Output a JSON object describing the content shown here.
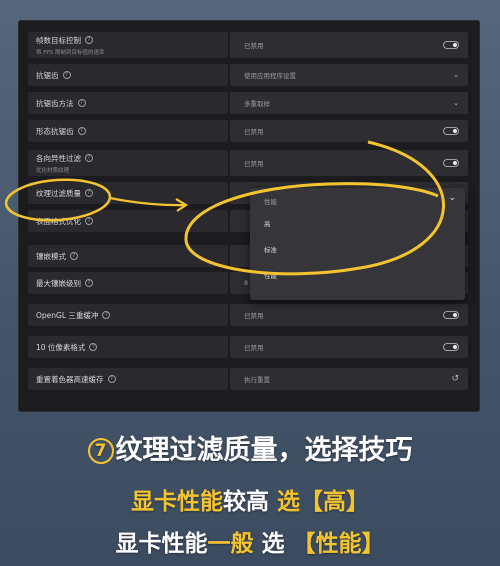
{
  "settings": [
    {
      "label": "帧数目标控制",
      "sub": "将 FPS 限制到目标值的速率",
      "value": "已禁用",
      "control": "toggle"
    },
    {
      "label": "抗锯齿",
      "sub": "",
      "value": "使用应用程序设置",
      "control": "chevron"
    },
    {
      "label": "抗锯齿方法",
      "sub": "",
      "value": "多重取样",
      "control": "chevron"
    },
    {
      "label": "形态抗锯齿",
      "sub": "",
      "value": "已禁用",
      "control": "toggle"
    },
    {
      "label": "各向异性过滤",
      "sub": "优化材质纹理",
      "value": "已禁用",
      "control": "toggle"
    },
    {
      "label": "纹理过滤质量",
      "sub": "",
      "value": "性能",
      "control": "chevron"
    },
    {
      "label": "表面格式优化",
      "sub": "",
      "value": "",
      "control": "none"
    },
    {
      "label": "镶嵌模式",
      "sub": "",
      "value": "",
      "control": "none"
    },
    {
      "label": "最大镶嵌级别",
      "sub": "",
      "value": "8",
      "control": "chevron"
    },
    {
      "label": "OpenGL 三重缓冲",
      "sub": "",
      "value": "已禁用",
      "control": "toggle"
    },
    {
      "label": "10 位像素格式",
      "sub": "",
      "value": "已禁用",
      "control": "toggle"
    },
    {
      "label": "重置着色器高速缓存",
      "sub": "",
      "value": "执行重置",
      "control": "reset"
    }
  ],
  "dropdown": {
    "current": "性能",
    "options": [
      "高",
      "标准",
      "性能"
    ]
  },
  "caption": {
    "num": "7",
    "line1": "纹理过滤质量，选择技巧",
    "line2_a": "显卡性能",
    "line2_b": "较高",
    "line2_c": " 选",
    "line2_d": "【高】",
    "line3_a": "显卡性能",
    "line3_b": "一般",
    "line3_c": " 选 ",
    "line3_d": "【性能】"
  },
  "colors": {
    "accent": "#f4c430",
    "panel": "#2a2a2e"
  }
}
